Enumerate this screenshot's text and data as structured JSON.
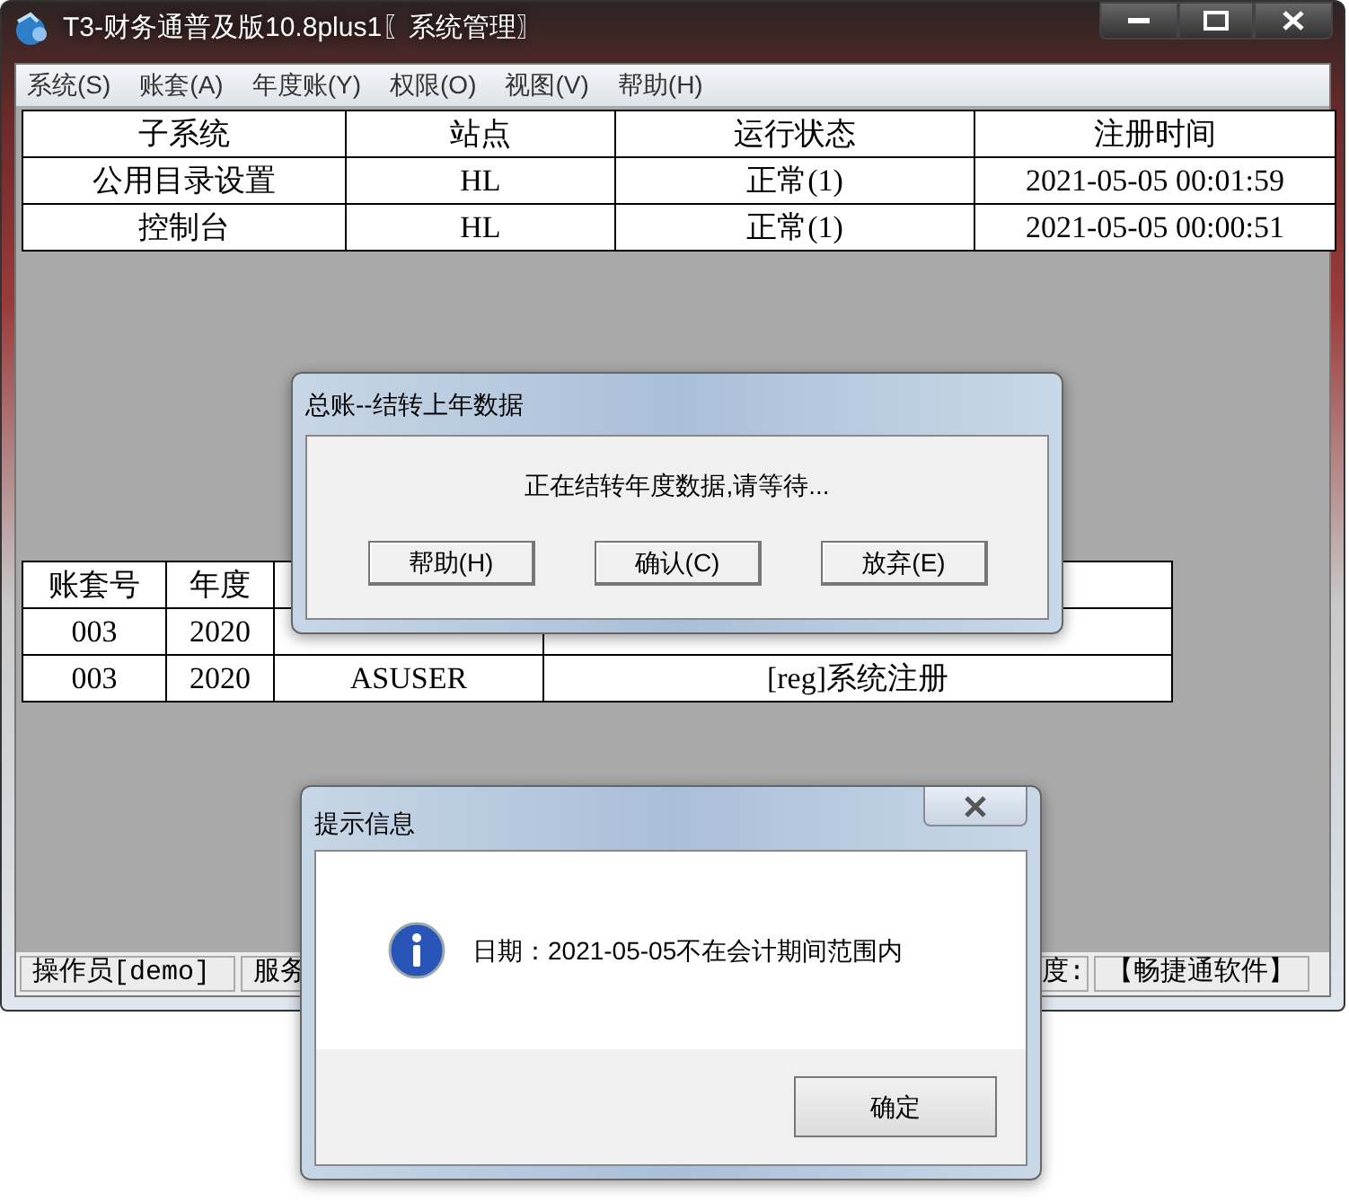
{
  "window": {
    "title": "T3-财务通普及版10.8plus1〖系统管理〗"
  },
  "menu": [
    "系统(S)",
    "账套(A)",
    "年度账(Y)",
    "权限(O)",
    "视图(V)",
    "帮助(H)"
  ],
  "top_table": {
    "columns": [
      "子系统",
      "站点",
      "运行状态",
      "注册时间"
    ],
    "rows": [
      [
        "公用目录设置",
        "HL",
        "正常(1)",
        "2021-05-05 00:01:59"
      ],
      [
        "控制台",
        "HL",
        "正常(1)",
        "2021-05-05 00:00:51"
      ]
    ]
  },
  "bottom_table": {
    "columns": [
      "账套号",
      "年度"
    ],
    "rows": [
      [
        "003",
        "2020"
      ],
      [
        "003",
        "2020",
        "ASUSER",
        "[reg]系统注册"
      ]
    ]
  },
  "status_bar": [
    "操作员[demo]",
    "服务",
    "度:",
    "【畅捷通软件】"
  ],
  "carry_dialog": {
    "title": "总账--结转上年数据",
    "message": "正在结转年度数据,请等待...",
    "buttons": [
      "帮助(H)",
      "确认(C)",
      "放弃(E)"
    ]
  },
  "info_dialog": {
    "title": "提示信息",
    "message": "日期：2021-05-05不在会计期间范围内",
    "button": "确定"
  }
}
